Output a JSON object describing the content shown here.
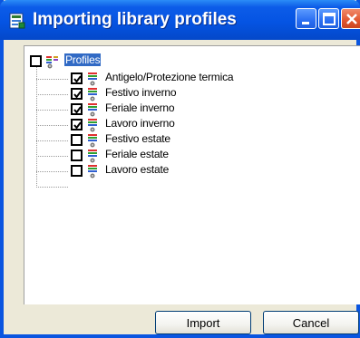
{
  "window": {
    "title": "Importing library profiles",
    "title_icon": "window-app-icon",
    "controls": [
      "minimize-icon",
      "maximize-icon",
      "close-icon"
    ]
  },
  "tree": {
    "root": {
      "label": "Profiles",
      "checked": false,
      "selected": true,
      "icon": "profiles-icon"
    },
    "items": [
      {
        "label": "Antigelo/Protezione termica",
        "checked": true,
        "icon": "profile-icon"
      },
      {
        "label": "Festivo inverno",
        "checked": true,
        "icon": "profile-icon"
      },
      {
        "label": "Feriale inverno",
        "checked": true,
        "icon": "profile-icon"
      },
      {
        "label": "Lavoro inverno",
        "checked": true,
        "icon": "profile-icon"
      },
      {
        "label": "Festivo estate",
        "checked": false,
        "icon": "profile-icon"
      },
      {
        "label": "Feriale estate",
        "checked": false,
        "icon": "profile-icon"
      },
      {
        "label": "Lavoro estate",
        "checked": false,
        "icon": "profile-icon"
      }
    ]
  },
  "buttons": {
    "import_label": "Import",
    "cancel_label": "Cancel"
  },
  "colors": {
    "title_bar": "#0554e3",
    "selection": "#316ac5",
    "face": "#ece9d8"
  }
}
